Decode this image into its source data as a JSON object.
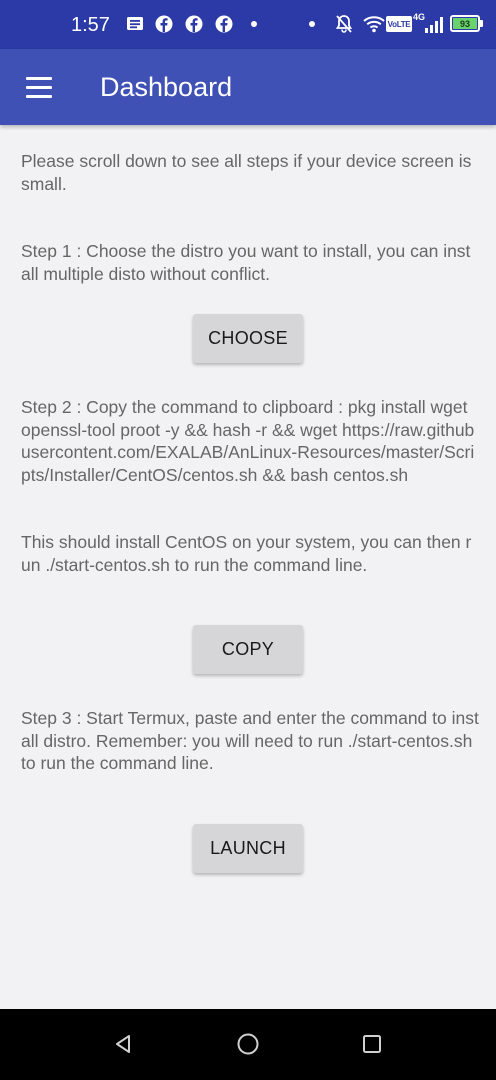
{
  "status_bar": {
    "time": "1:57",
    "network_label": "VoLTE",
    "network_gen": "4G",
    "battery": "93",
    "icons": [
      "message-icon",
      "facebook-icon",
      "facebook-icon",
      "facebook-icon",
      "dot-icon",
      "dot-icon",
      "mute-icon",
      "wifi-icon",
      "volte-icon",
      "signal-icon",
      "battery-icon"
    ],
    "colors": {
      "background": "#2b3aa6",
      "battery_fill": "#6bd36b"
    }
  },
  "app_bar": {
    "title": "Dashboard",
    "menu_icon": "hamburger-menu-icon",
    "colors": {
      "background": "#3f51b5",
      "text": "#ffffff"
    }
  },
  "main": {
    "intro_text": "Please scroll down to see all steps if your device screen is small.",
    "step1_text": "Step 1 : Choose the distro you want to install, you can install multiple disto without conflict.",
    "choose_label": "CHOOSE",
    "step2_text": "Step 2 : Copy the command to clipboard : pkg install wget openssl-tool proot -y && hash -r && wget https://raw.githubusercontent.com/EXALAB/AnLinux-Resources/master/Scripts/Installer/CentOS/centos.sh && bash centos.sh",
    "step2_note": "This should install CentOS on your system, you can then run ./start-centos.sh to run the command line.",
    "copy_label": "COPY",
    "step3_text": "Step 3 : Start Termux, paste and enter the command to install distro. Remember: you will need to run ./start-centos.sh to run the command line.",
    "launch_label": "LAUNCH",
    "colors": {
      "background": "#f2f2f4",
      "text": "#666666",
      "button": "#d6d6d8"
    }
  },
  "nav_bar": {
    "icons": [
      "back-icon",
      "home-icon",
      "recents-icon"
    ]
  }
}
